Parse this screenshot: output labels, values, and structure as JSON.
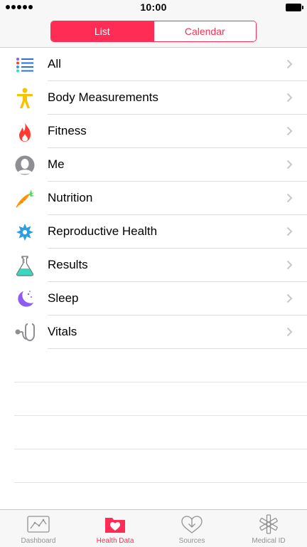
{
  "status_bar": {
    "time": "10:00"
  },
  "segmented_control": {
    "options": [
      {
        "label": "List",
        "selected": true
      },
      {
        "label": "Calendar",
        "selected": false
      }
    ]
  },
  "categories": [
    {
      "label": "All",
      "icon": "list-icon"
    },
    {
      "label": "Body Measurements",
      "icon": "person-icon"
    },
    {
      "label": "Fitness",
      "icon": "flame-icon"
    },
    {
      "label": "Me",
      "icon": "profile-icon"
    },
    {
      "label": "Nutrition",
      "icon": "carrot-icon"
    },
    {
      "label": "Reproductive Health",
      "icon": "flower-icon"
    },
    {
      "label": "Results",
      "icon": "flask-icon"
    },
    {
      "label": "Sleep",
      "icon": "moon-icon"
    },
    {
      "label": "Vitals",
      "icon": "stethoscope-icon"
    }
  ],
  "tab_bar": {
    "tabs": [
      {
        "label": "Dashboard",
        "icon": "dashboard-icon",
        "active": false
      },
      {
        "label": "Health Data",
        "icon": "health-data-icon",
        "active": true
      },
      {
        "label": "Sources",
        "icon": "sources-icon",
        "active": false
      },
      {
        "label": "Medical ID",
        "icon": "medical-id-icon",
        "active": false
      }
    ]
  },
  "colors": {
    "accent": "#ff2d55",
    "fitness": "#ff3b30",
    "body": "#f5c400",
    "nutrition": "#ff9500",
    "reproductive": "#2e9ee0",
    "results": "#3ad6c0",
    "sleep": "#8e5cf0",
    "inactive_tab": "#929292"
  }
}
